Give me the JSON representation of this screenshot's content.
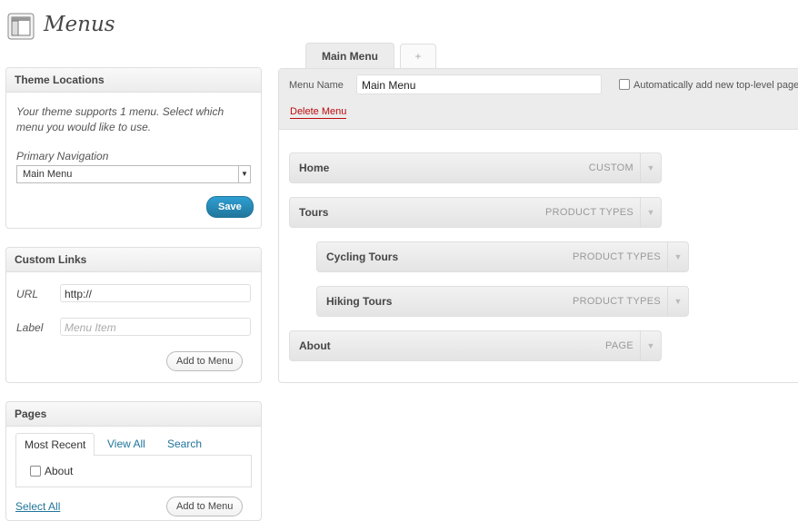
{
  "page": {
    "title": "Menus"
  },
  "theme_locations": {
    "title": "Theme Locations",
    "description": "Your theme supports 1 menu. Select which menu you would like to use.",
    "field_label": "Primary Navigation",
    "selected_value": "Main Menu",
    "save_label": "Save"
  },
  "custom_links": {
    "title": "Custom Links",
    "url_label": "URL",
    "url_value": "http://",
    "label_label": "Label",
    "label_placeholder": "Menu Item",
    "add_label": "Add to Menu"
  },
  "pages_box": {
    "title": "Pages",
    "tabs": [
      "Most Recent",
      "View All",
      "Search"
    ],
    "items": [
      "About"
    ],
    "select_all": "Select All",
    "add_label": "Add to Menu"
  },
  "menu_tabs": {
    "active": "Main Menu",
    "add": "+"
  },
  "menu_editor": {
    "name_label": "Menu Name",
    "name_value": "Main Menu",
    "auto_add_label": "Automatically add new top-level pages",
    "delete_label": "Delete Menu",
    "items": [
      {
        "title": "Home",
        "type": "CUSTOM",
        "depth": 0
      },
      {
        "title": "Tours",
        "type": "PRODUCT TYPES",
        "depth": 0
      },
      {
        "title": "Cycling Tours",
        "type": "PRODUCT TYPES",
        "depth": 1
      },
      {
        "title": "Hiking Tours",
        "type": "PRODUCT TYPES",
        "depth": 1
      },
      {
        "title": "About",
        "type": "PAGE",
        "depth": 0
      }
    ]
  },
  "colors": {
    "accent": "#21759b",
    "delete": "#bc0b0b",
    "panel": "#ececec"
  }
}
